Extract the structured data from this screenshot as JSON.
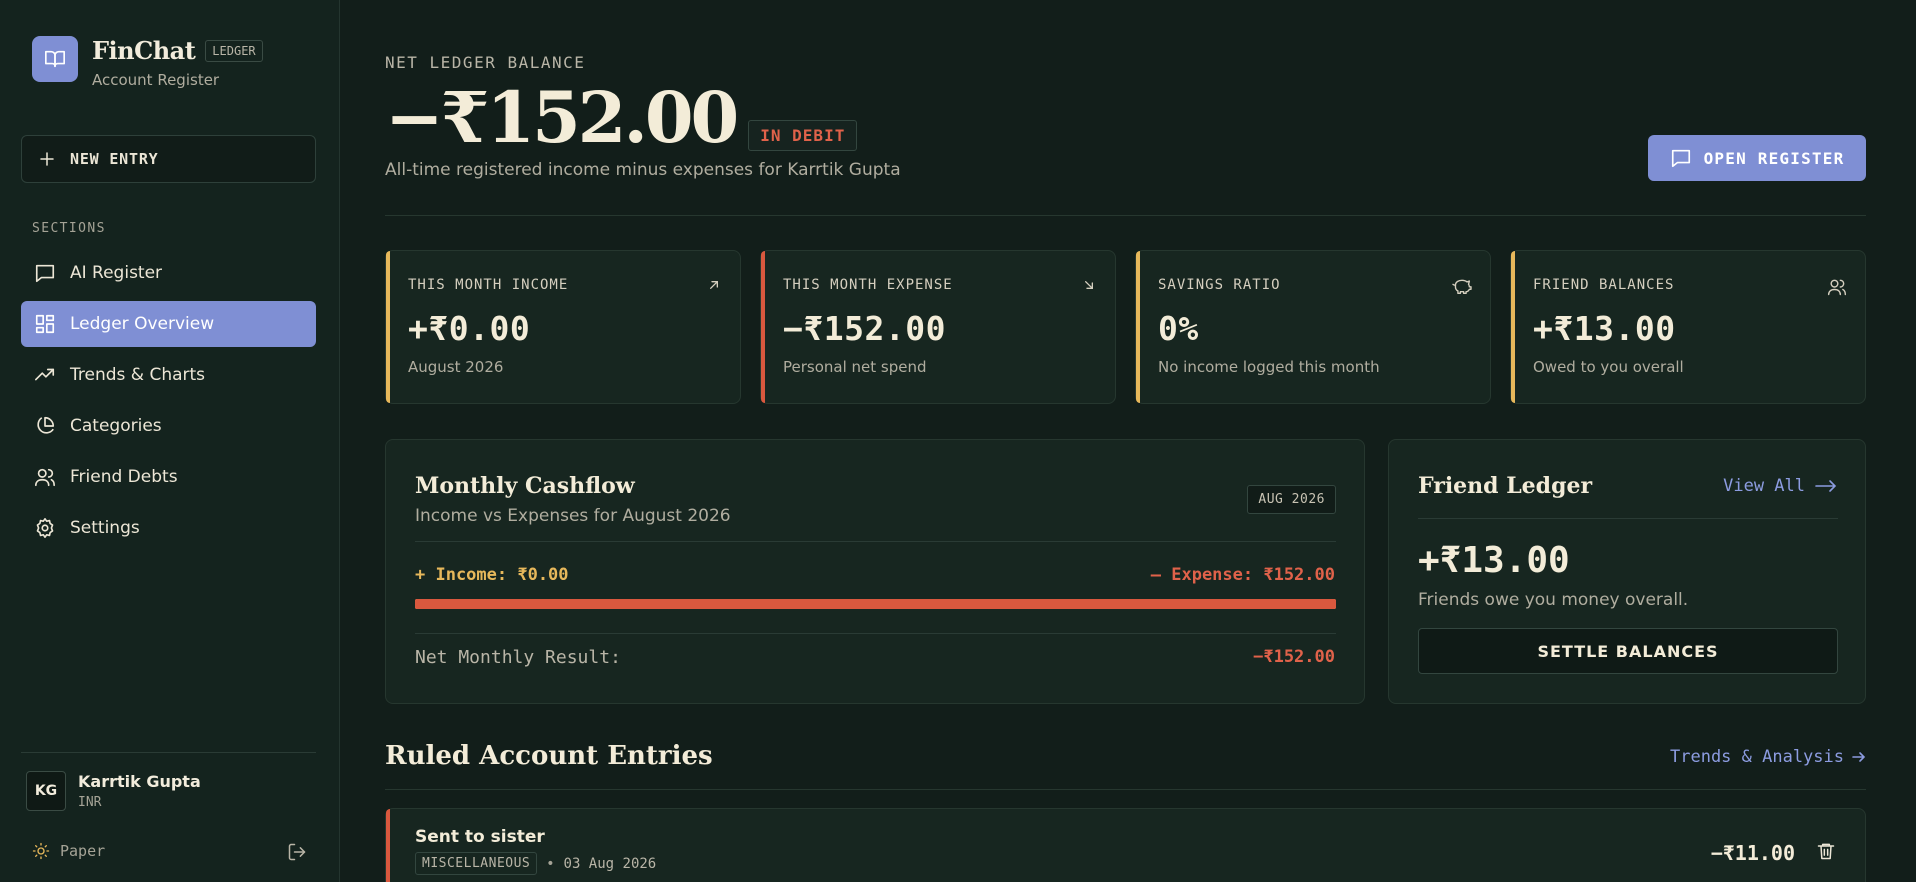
{
  "colors": {
    "accent": "#7f8fd4",
    "income": "#e7b85b",
    "expense": "#e0624a",
    "background": "#121e1a",
    "panel": "#172620"
  },
  "brand": {
    "name": "FinChat",
    "tag": "LEDGER",
    "subtitle": "Account Register",
    "icon": "book-open-icon"
  },
  "sidebar": {
    "new_entry_label": "NEW ENTRY",
    "sections_heading": "SECTIONS",
    "items": [
      {
        "label": "AI Register",
        "icon": "message-square-icon",
        "active": false
      },
      {
        "label": "Ledger Overview",
        "icon": "dashboard-icon",
        "active": true
      },
      {
        "label": "Trends & Charts",
        "icon": "trending-up-icon",
        "active": false
      },
      {
        "label": "Categories",
        "icon": "pie-chart-icon",
        "active": false
      },
      {
        "label": "Friend Debts",
        "icon": "users-icon",
        "active": false
      },
      {
        "label": "Settings",
        "icon": "gear-icon",
        "active": false
      }
    ],
    "user": {
      "initials": "KG",
      "name": "Karrtik Gupta",
      "currency": "INR"
    },
    "theme_label": "Paper"
  },
  "header": {
    "eyebrow": "NET LEDGER BALANCE",
    "balance": "−₹152.00",
    "status_badge": "IN DEBIT",
    "subtitle": "All-time registered income minus expenses for Karrtik Gupta",
    "open_register_label": "OPEN REGISTER"
  },
  "cards": [
    {
      "label": "THIS MONTH INCOME",
      "value": "+₹0.00",
      "sub": "August 2026",
      "icon": "arrow-up-right-icon",
      "stripe": "#e7b85b"
    },
    {
      "label": "THIS MONTH EXPENSE",
      "value": "−₹152.00",
      "sub": "Personal net spend",
      "icon": "arrow-down-right-icon",
      "stripe": "#d9583e"
    },
    {
      "label": "SAVINGS RATIO",
      "value": "0%",
      "sub": "No income logged this month",
      "icon": "piggy-bank-icon",
      "stripe": "#e7b85b"
    },
    {
      "label": "FRIEND BALANCES",
      "value": "+₹13.00",
      "sub": "Owed to you overall",
      "icon": "users-icon",
      "stripe": "#e7b85b"
    }
  ],
  "cashflow": {
    "title": "Monthly Cashflow",
    "subtitle": "Income vs Expenses for August 2026",
    "period_badge": "AUG 2026",
    "income_label": "+ Income: ₹0.00",
    "expense_label": "– Expense: ₹152.00",
    "income_value": 0,
    "expense_value": 152,
    "net_label": "Net Monthly Result:",
    "net_value": "−₹152.00"
  },
  "friend_ledger": {
    "title": "Friend Ledger",
    "view_all_label": "View All",
    "amount": "+₹13.00",
    "subtitle": "Friends owe you money overall.",
    "settle_label": "SETTLE BALANCES"
  },
  "entries": {
    "title": "Ruled Account Entries",
    "link_label": "Trends & Analysis",
    "items": [
      {
        "title": "Sent to sister",
        "category": "MISCELLANEOUS",
        "separator": "•",
        "date": "03 Aug 2026",
        "amount": "−₹11.00"
      }
    ]
  }
}
